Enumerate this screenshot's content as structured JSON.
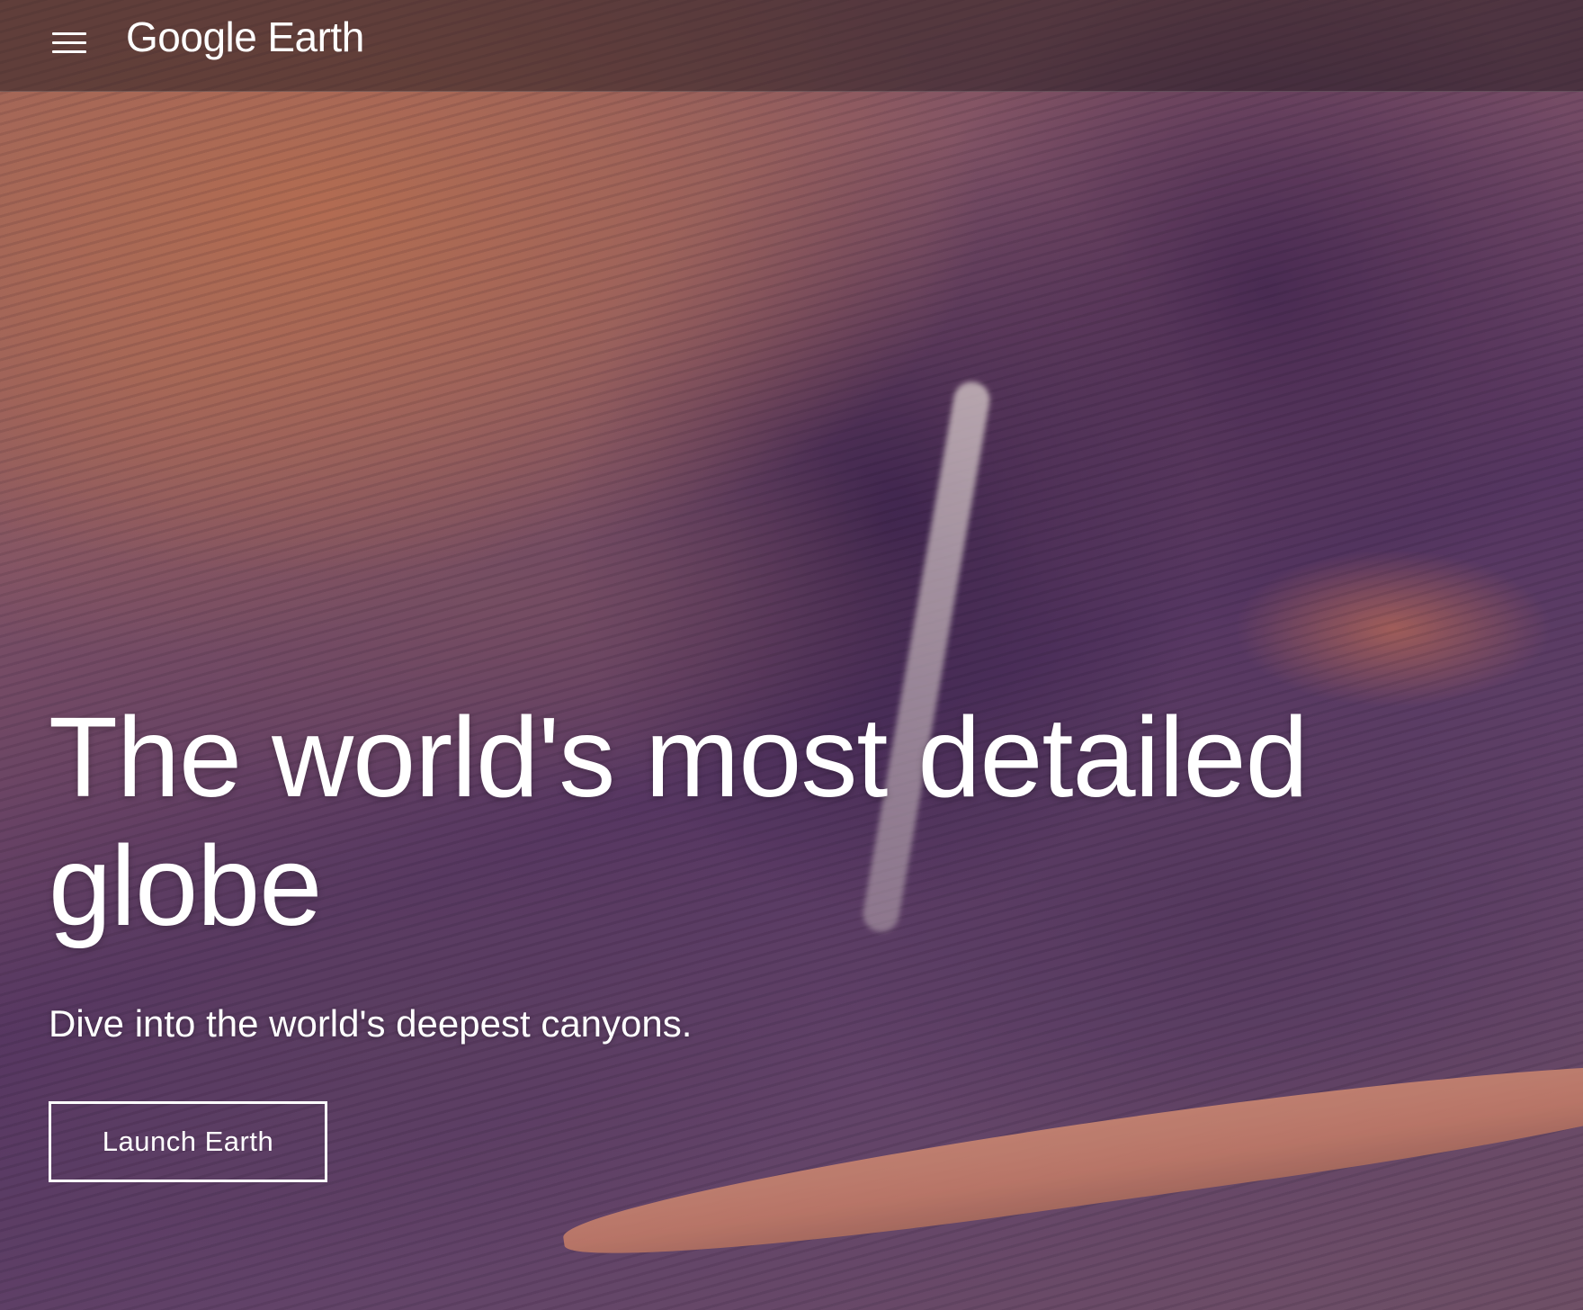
{
  "header": {
    "brand_google": "Google",
    "brand_product": "Earth",
    "menu_icon": "hamburger-menu-icon"
  },
  "hero": {
    "headline": "The world's most detailed globe",
    "subhead": "Dive into the world's deepest canyons.",
    "cta_label": "Launch Earth"
  },
  "colors": {
    "text": "#ffffff",
    "topbar_overlay": "rgba(40,30,35,0.55)",
    "button_border": "#ffffff"
  }
}
